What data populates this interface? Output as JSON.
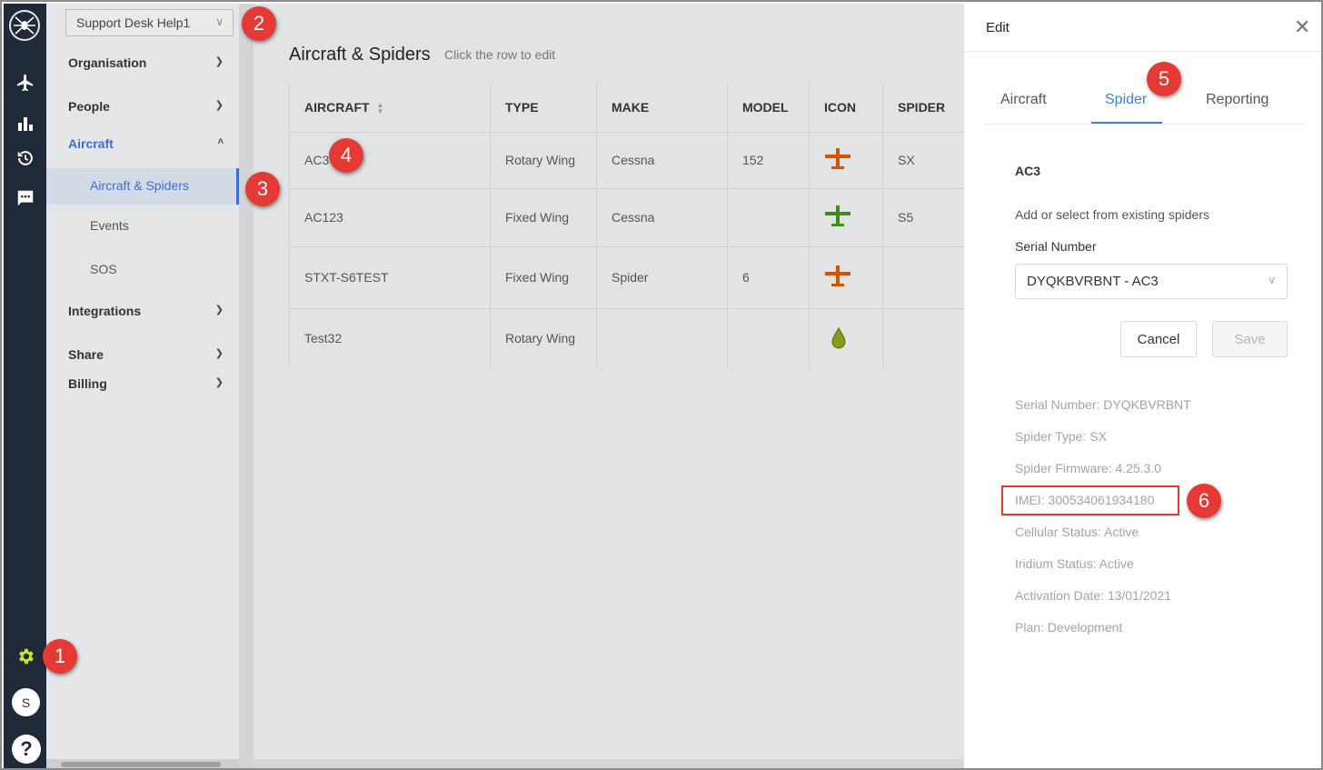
{
  "org_selector": {
    "value": "Support Desk Help1"
  },
  "nav": {
    "sections": [
      {
        "label": "Organisation"
      },
      {
        "label": "People"
      },
      {
        "label": "Aircraft"
      },
      {
        "label": "Integrations"
      },
      {
        "label": "Share"
      },
      {
        "label": "Billing"
      }
    ],
    "aircraft_sub": [
      "Aircraft & Spiders",
      "Events",
      "SOS"
    ]
  },
  "rail": {
    "icons": [
      "spider-logo-icon",
      "airplane-icon",
      "bar-chart-icon",
      "history-icon",
      "chat-icon",
      "gear-icon"
    ],
    "avatar_initial": "S",
    "help_glyph": "?",
    "accent": "#c6e82a",
    "background": "#1f2937"
  },
  "main": {
    "title": "Aircraft & Spiders",
    "hint": "Click the row to edit",
    "columns": [
      "AIRCRAFT",
      "TYPE",
      "MAKE",
      "MODEL",
      "ICON",
      "SPIDER"
    ],
    "rows": [
      {
        "aircraft": "AC3",
        "type": "Rotary Wing",
        "make": "Cessna",
        "model": "152",
        "icon": "plane-orange-icon",
        "icon_color": "#d35400",
        "spider": "SX"
      },
      {
        "aircraft": "AC123",
        "type": "Fixed Wing",
        "make": "Cessna",
        "model": "",
        "icon": "plane-green-icon",
        "icon_color": "#3f8a1f",
        "spider": "S5"
      },
      {
        "aircraft": "STXT-S6TEST",
        "type": "Fixed Wing",
        "make": "Spider",
        "model": "6",
        "icon": "plane-orange-icon",
        "icon_color": "#d35400",
        "spider": ""
      },
      {
        "aircraft": "Test32",
        "type": "Rotary Wing",
        "make": "",
        "model": "",
        "icon": "drop-olive-icon",
        "icon_color": "#8a9a1a",
        "spider": ""
      }
    ]
  },
  "drawer": {
    "title": "Edit",
    "tabs": [
      "Aircraft",
      "Spider",
      "Reporting"
    ],
    "active_tab": "Spider",
    "section_title": "AC3",
    "hint": "Add or select from existing spiders",
    "serial_label": "Serial Number",
    "serial_value": "DYQKBVRBNT - AC3",
    "cancel_label": "Cancel",
    "save_label": "Save",
    "info": [
      "Serial Number: DYQKBVRBNT",
      "Spider Type: SX",
      "Spider Firmware: 4.25.3.0",
      "IMEI: 300534061934180",
      "Cellular Status: Active",
      "Iridium Status: Active",
      "Activation Date: 13/01/2021",
      "Plan: Development"
    ],
    "accent": "#3b82e0"
  },
  "callouts": [
    "1",
    "2",
    "3",
    "4",
    "5",
    "6"
  ],
  "callout_color": "#e53935"
}
